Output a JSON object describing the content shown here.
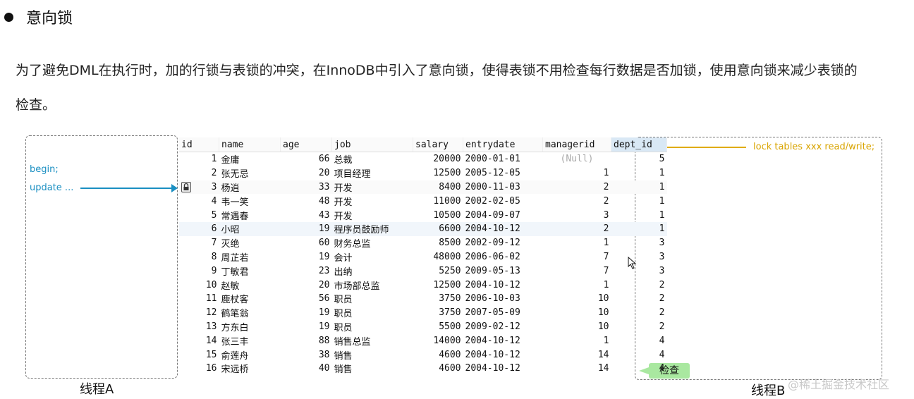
{
  "heading": "意向锁",
  "paragraph": "为了避免DML在执行时，加的行锁与表锁的冲突，在InnoDB中引入了意向锁，使得表锁不用检查每行数据是否加锁，使用意向锁来减少表锁的检查。",
  "thread_a": {
    "label": "线程A",
    "begin": "begin;",
    "update": "update ..."
  },
  "thread_b": {
    "label": "线程B",
    "lock": "lock tables xxx read/write;",
    "check": "检查"
  },
  "watermark": "@稀土掘金技术社区",
  "colors": {
    "blue_arrow": "#1a8fc2",
    "gold_arrow": "#e0ab00",
    "check_badge": "#a9e8a0"
  },
  "icons": {
    "locked_row": "padlock-icon"
  },
  "table": {
    "columns": [
      "id",
      "name",
      "age",
      "job",
      "salary",
      "entrydate",
      "managerid",
      "dept_id"
    ],
    "rows": [
      [
        "1",
        "金庸",
        "66",
        "总裁",
        "20000",
        "2000-01-01",
        "(Null)",
        "5"
      ],
      [
        "2",
        "张无忌",
        "20",
        "项目经理",
        "12500",
        "2005-12-05",
        "1",
        "1"
      ],
      [
        "3",
        "杨逍",
        "33",
        "开发",
        "8400",
        "2000-11-03",
        "2",
        "1"
      ],
      [
        "4",
        "韦一笑",
        "48",
        "开发",
        "11000",
        "2002-02-05",
        "2",
        "1"
      ],
      [
        "5",
        "常遇春",
        "43",
        "开发",
        "10500",
        "2004-09-07",
        "3",
        "1"
      ],
      [
        "6",
        "小昭",
        "19",
        "程序员鼓励师",
        "6600",
        "2004-10-12",
        "2",
        "1"
      ],
      [
        "7",
        "灭绝",
        "60",
        "财务总监",
        "8500",
        "2002-09-12",
        "1",
        "3"
      ],
      [
        "8",
        "周芷若",
        "19",
        "会计",
        "48000",
        "2006-06-02",
        "7",
        "3"
      ],
      [
        "9",
        "丁敏君",
        "23",
        "出纳",
        "5250",
        "2009-05-13",
        "7",
        "3"
      ],
      [
        "10",
        "赵敏",
        "20",
        "市场部总监",
        "12500",
        "2004-10-12",
        "1",
        "2"
      ],
      [
        "11",
        "鹿杖客",
        "56",
        "职员",
        "3750",
        "2006-10-03",
        "10",
        "2"
      ],
      [
        "12",
        "鹤笔翁",
        "19",
        "职员",
        "3750",
        "2007-05-09",
        "10",
        "2"
      ],
      [
        "13",
        "方东白",
        "19",
        "职员",
        "5500",
        "2009-02-12",
        "10",
        "2"
      ],
      [
        "14",
        "张三丰",
        "88",
        "销售总监",
        "14000",
        "2004-10-12",
        "1",
        "4"
      ],
      [
        "15",
        "俞莲舟",
        "38",
        "销售",
        "4600",
        "2004-10-12",
        "14",
        "4"
      ],
      [
        "16",
        "宋远桥",
        "40",
        "销售",
        "4600",
        "2004-10-12",
        "14",
        "4"
      ]
    ]
  }
}
